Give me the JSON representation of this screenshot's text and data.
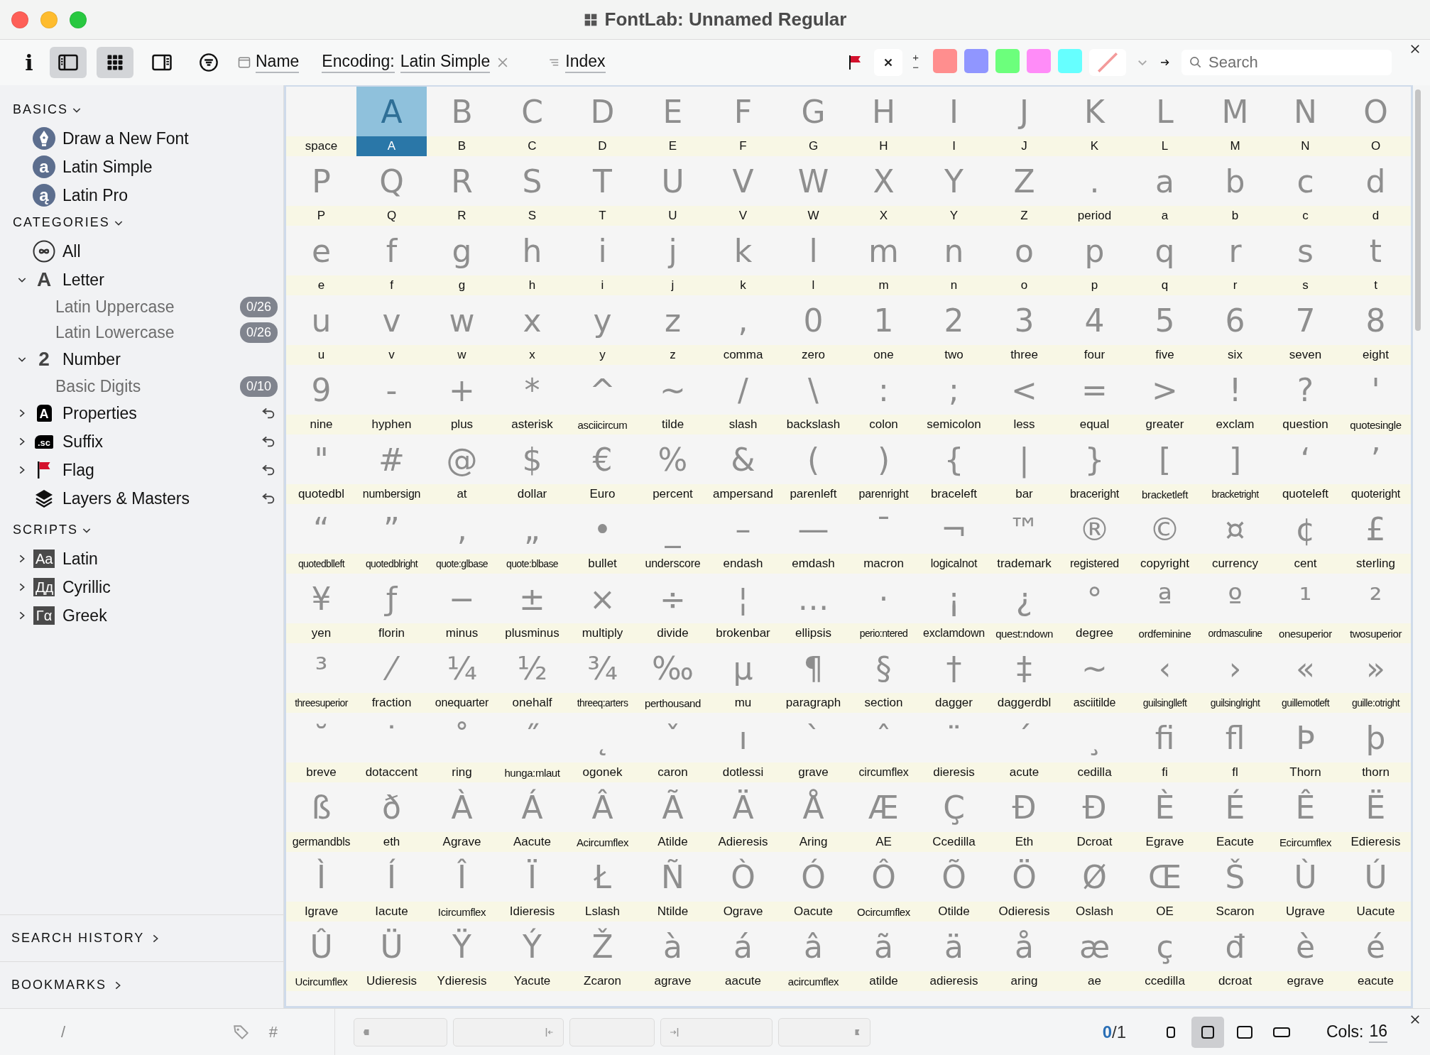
{
  "window": {
    "title": "FontLab: Unnamed Regular"
  },
  "toolbar": {
    "info": "i",
    "view_buttons": [
      {
        "kind": "sidebar",
        "selected": true
      },
      {
        "kind": "grid",
        "selected": true
      },
      {
        "kind": "panel",
        "selected": false
      }
    ],
    "name_label": "Name",
    "encoding_label": "Encoding:",
    "encoding_value": "Latin Simple",
    "index_label": "Index",
    "plus": "+",
    "minus": "−",
    "swatches": [
      {
        "color": "#ff8e8e"
      },
      {
        "color": "#9096ff"
      },
      {
        "color": "#6cff7c"
      },
      {
        "color": "#ff8cf8"
      },
      {
        "color": "#66ffff"
      }
    ],
    "search": {
      "placeholder": "Search"
    }
  },
  "sidebar": {
    "basics": {
      "title": "BASICS",
      "items": [
        {
          "label": "Draw a New Font",
          "kind": "pen"
        },
        {
          "label": "Latin Simple",
          "kind": "letter",
          "icon_text": "a"
        },
        {
          "label": "Latin Pro",
          "kind": "letter",
          "icon_text": "ą"
        }
      ]
    },
    "categories": {
      "title": "CATEGORIES",
      "items": [
        {
          "label": "All",
          "kind": "all"
        },
        {
          "label": "Letter",
          "kind": "glyph",
          "icon_text": "A",
          "expanded": true,
          "children": [
            {
              "label": "Latin Uppercase",
              "count": "0/26"
            },
            {
              "label": "Latin Lowercase",
              "count": "0/26"
            }
          ]
        },
        {
          "label": "Number",
          "kind": "glyph",
          "icon_text": "2",
          "expanded": true,
          "children": [
            {
              "label": "Basic Digits",
              "count": "0/10"
            }
          ]
        },
        {
          "label": "Properties",
          "kind": "tag",
          "icon_text": "A",
          "expanded": false,
          "reset": true
        },
        {
          "label": "Suffix",
          "kind": "suffix",
          "icon_text": ".sc",
          "expanded": false,
          "reset": true
        },
        {
          "label": "Flag",
          "kind": "flag",
          "expanded": false,
          "reset": true
        },
        {
          "label": "Layers & Masters",
          "kind": "layers",
          "reset": true
        }
      ]
    },
    "scripts": {
      "title": "SCRIPTS",
      "items": [
        {
          "label": "Latin",
          "icon_text": "Aa",
          "expanded": false
        },
        {
          "label": "Cyrillic",
          "icon_text": "Дд",
          "expanded": false
        },
        {
          "label": "Greek",
          "icon_text": "Γα",
          "expanded": false
        }
      ]
    },
    "search_history": "SEARCH HISTORY",
    "bookmarks": "BOOKMARKS"
  },
  "glyph_grid": {
    "rows": [
      [
        {
          "name": "space",
          "selected": false
        },
        {
          "glyph": "A",
          "name": "A",
          "selected": true
        },
        {
          "glyph": "B",
          "name": "B",
          "selected": false
        },
        {
          "glyph": "C",
          "name": "C",
          "selected": false
        },
        {
          "glyph": "D",
          "name": "D",
          "selected": false
        },
        {
          "glyph": "E",
          "name": "E",
          "selected": false
        },
        {
          "glyph": "F",
          "name": "F",
          "selected": false
        },
        {
          "glyph": "G",
          "name": "G",
          "selected": false
        },
        {
          "glyph": "H",
          "name": "H",
          "selected": false
        },
        {
          "glyph": "I",
          "name": "I",
          "selected": false
        },
        {
          "glyph": "J",
          "name": "J",
          "selected": false
        },
        {
          "glyph": "K",
          "name": "K",
          "selected": false
        },
        {
          "glyph": "L",
          "name": "L",
          "selected": false
        },
        {
          "glyph": "M",
          "name": "M",
          "selected": false
        },
        {
          "glyph": "N",
          "name": "N",
          "selected": false
        },
        {
          "glyph": "O",
          "name": "O",
          "selected": false
        }
      ],
      [
        {
          "glyph": "P",
          "name": "P",
          "selected": false
        },
        {
          "glyph": "Q",
          "name": "Q",
          "selected": false
        },
        {
          "glyph": "R",
          "name": "R",
          "selected": false
        },
        {
          "glyph": "S",
          "name": "S",
          "selected": false
        },
        {
          "glyph": "T",
          "name": "T",
          "selected": false
        },
        {
          "glyph": "U",
          "name": "U",
          "selected": false
        },
        {
          "glyph": "V",
          "name": "V",
          "selected": false
        },
        {
          "glyph": "W",
          "name": "W",
          "selected": false
        },
        {
          "glyph": "X",
          "name": "X",
          "selected": false
        },
        {
          "glyph": "Y",
          "name": "Y",
          "selected": false
        },
        {
          "glyph": "Z",
          "name": "Z",
          "selected": false
        },
        {
          "glyph": ".",
          "name": "period",
          "selected": false
        },
        {
          "glyph": "a",
          "name": "a",
          "selected": false
        },
        {
          "glyph": "b",
          "name": "b",
          "selected": false
        },
        {
          "glyph": "c",
          "name": "c",
          "selected": false
        },
        {
          "glyph": "d",
          "name": "d",
          "selected": false
        }
      ],
      [
        {
          "glyph": "e",
          "name": "e",
          "selected": false
        },
        {
          "glyph": "f",
          "name": "f",
          "selected": false
        },
        {
          "glyph": "g",
          "name": "g",
          "selected": false
        },
        {
          "glyph": "h",
          "name": "h",
          "selected": false
        },
        {
          "glyph": "i",
          "name": "i",
          "selected": false
        },
        {
          "glyph": "j",
          "name": "j",
          "selected": false
        },
        {
          "glyph": "k",
          "name": "k",
          "selected": false
        },
        {
          "glyph": "l",
          "name": "l",
          "selected": false
        },
        {
          "glyph": "m",
          "name": "m",
          "selected": false
        },
        {
          "glyph": "n",
          "name": "n",
          "selected": false
        },
        {
          "glyph": "o",
          "name": "o",
          "selected": false
        },
        {
          "glyph": "p",
          "name": "p",
          "selected": false
        },
        {
          "glyph": "q",
          "name": "q",
          "selected": false
        },
        {
          "glyph": "r",
          "name": "r",
          "selected": false
        },
        {
          "glyph": "s",
          "name": "s",
          "selected": false
        },
        {
          "glyph": "t",
          "name": "t",
          "selected": false
        }
      ],
      [
        {
          "glyph": "u",
          "name": "u",
          "selected": false
        },
        {
          "glyph": "v",
          "name": "v",
          "selected": false
        },
        {
          "glyph": "w",
          "name": "w",
          "selected": false
        },
        {
          "glyph": "x",
          "name": "x",
          "selected": false
        },
        {
          "glyph": "y",
          "name": "y",
          "selected": false
        },
        {
          "glyph": "z",
          "name": "z",
          "selected": false
        },
        {
          "glyph": ",",
          "name": "comma",
          "selected": false
        },
        {
          "glyph": "0",
          "name": "zero",
          "selected": false
        },
        {
          "glyph": "1",
          "name": "one",
          "selected": false
        },
        {
          "glyph": "2",
          "name": "two",
          "selected": false
        },
        {
          "glyph": "3",
          "name": "three",
          "selected": false
        },
        {
          "glyph": "4",
          "name": "four",
          "selected": false
        },
        {
          "glyph": "5",
          "name": "five",
          "selected": false
        },
        {
          "glyph": "6",
          "name": "six",
          "selected": false
        },
        {
          "glyph": "7",
          "name": "seven",
          "selected": false
        },
        {
          "glyph": "8",
          "name": "eight",
          "selected": false
        }
      ],
      [
        {
          "glyph": "9",
          "name": "nine",
          "selected": false
        },
        {
          "glyph": "-",
          "name": "hyphen",
          "selected": false
        },
        {
          "glyph": "+",
          "name": "plus",
          "selected": false
        },
        {
          "glyph": "*",
          "name": "asterisk",
          "selected": false
        },
        {
          "glyph": "^",
          "name": "asciicircum",
          "selected": false
        },
        {
          "glyph": "~",
          "name": "tilde",
          "selected": false
        },
        {
          "glyph": "/",
          "name": "slash",
          "selected": false
        },
        {
          "glyph": "\\",
          "name": "backslash",
          "selected": false
        },
        {
          "glyph": ":",
          "name": "colon",
          "selected": false
        },
        {
          "glyph": ";",
          "name": "semicolon",
          "selected": false
        },
        {
          "glyph": "<",
          "name": "less",
          "selected": false
        },
        {
          "glyph": "=",
          "name": "equal",
          "selected": false
        },
        {
          "glyph": ">",
          "name": "greater",
          "selected": false
        },
        {
          "glyph": "!",
          "name": "exclam",
          "selected": false
        },
        {
          "glyph": "?",
          "name": "question",
          "selected": false
        },
        {
          "glyph": "'",
          "name": "quotesingle",
          "selected": false
        }
      ],
      [
        {
          "glyph": "\"",
          "name": "quotedbl",
          "selected": false
        },
        {
          "glyph": "#",
          "name": "numbersign",
          "selected": false
        },
        {
          "glyph": "@",
          "name": "at",
          "selected": false
        },
        {
          "glyph": "$",
          "name": "dollar",
          "selected": false
        },
        {
          "glyph": "€",
          "name": "Euro",
          "selected": false
        },
        {
          "glyph": "%",
          "name": "percent",
          "selected": false
        },
        {
          "glyph": "&",
          "name": "ampersand",
          "selected": false
        },
        {
          "glyph": "(",
          "name": "parenleft",
          "selected": false
        },
        {
          "glyph": ")",
          "name": "parenright",
          "selected": false
        },
        {
          "glyph": "{",
          "name": "braceleft",
          "selected": false
        },
        {
          "glyph": "|",
          "name": "bar",
          "selected": false
        },
        {
          "glyph": "}",
          "name": "braceright",
          "selected": false
        },
        {
          "glyph": "[",
          "name": "bracketleft",
          "selected": false
        },
        {
          "glyph": "]",
          "name": "bracketright",
          "selected": false
        },
        {
          "glyph": "‘",
          "name": "quoteleft",
          "selected": false
        },
        {
          "glyph": "’",
          "name": "quoteright",
          "selected": false
        }
      ],
      [
        {
          "glyph": "“",
          "name": "quotedblleft",
          "selected": false
        },
        {
          "glyph": "”",
          "name": "quotedblright",
          "selected": false
        },
        {
          "glyph": "‚",
          "name": "quote:glbase",
          "selected": false
        },
        {
          "glyph": "„",
          "name": "quote:blbase",
          "selected": false
        },
        {
          "glyph": "•",
          "name": "bullet",
          "selected": false
        },
        {
          "glyph": "_",
          "name": "underscore",
          "selected": false
        },
        {
          "glyph": "–",
          "name": "endash",
          "selected": false
        },
        {
          "glyph": "—",
          "name": "emdash",
          "selected": false
        },
        {
          "glyph": "¯",
          "name": "macron",
          "selected": false
        },
        {
          "glyph": "¬",
          "name": "logicalnot",
          "selected": false
        },
        {
          "glyph": "™",
          "name": "trademark",
          "selected": false
        },
        {
          "glyph": "®",
          "name": "registered",
          "selected": false
        },
        {
          "glyph": "©",
          "name": "copyright",
          "selected": false
        },
        {
          "glyph": "¤",
          "name": "currency",
          "selected": false
        },
        {
          "glyph": "¢",
          "name": "cent",
          "selected": false
        },
        {
          "glyph": "£",
          "name": "sterling",
          "selected": false
        }
      ],
      [
        {
          "glyph": "¥",
          "name": "yen",
          "selected": false
        },
        {
          "glyph": "ƒ",
          "name": "florin",
          "selected": false
        },
        {
          "glyph": "−",
          "name": "minus",
          "selected": false
        },
        {
          "glyph": "±",
          "name": "plusminus",
          "selected": false
        },
        {
          "glyph": "×",
          "name": "multiply",
          "selected": false
        },
        {
          "glyph": "÷",
          "name": "divide",
          "selected": false
        },
        {
          "glyph": "¦",
          "name": "brokenbar",
          "selected": false
        },
        {
          "glyph": "…",
          "name": "ellipsis",
          "selected": false
        },
        {
          "glyph": "·",
          "name": "perio:ntered",
          "selected": false
        },
        {
          "glyph": "¡",
          "name": "exclamdown",
          "selected": false
        },
        {
          "glyph": "¿",
          "name": "quest:ndown",
          "selected": false
        },
        {
          "glyph": "°",
          "name": "degree",
          "selected": false
        },
        {
          "glyph": "ª",
          "name": "ordfeminine",
          "selected": false
        },
        {
          "glyph": "º",
          "name": "ordmasculine",
          "selected": false
        },
        {
          "glyph": "¹",
          "name": "onesuperior",
          "selected": false
        },
        {
          "glyph": "²",
          "name": "twosuperior",
          "selected": false
        }
      ],
      [
        {
          "glyph": "³",
          "name": "threesuperior",
          "selected": false
        },
        {
          "glyph": "⁄",
          "name": "fraction",
          "selected": false
        },
        {
          "glyph": "¼",
          "name": "onequarter",
          "selected": false
        },
        {
          "glyph": "½",
          "name": "onehalf",
          "selected": false
        },
        {
          "glyph": "¾",
          "name": "threeq:arters",
          "selected": false
        },
        {
          "glyph": "‰",
          "name": "perthousand",
          "selected": false
        },
        {
          "glyph": "µ",
          "name": "mu",
          "selected": false
        },
        {
          "glyph": "¶",
          "name": "paragraph",
          "selected": false
        },
        {
          "glyph": "§",
          "name": "section",
          "selected": false
        },
        {
          "glyph": "†",
          "name": "dagger",
          "selected": false
        },
        {
          "glyph": "‡",
          "name": "daggerdbl",
          "selected": false
        },
        {
          "glyph": "~",
          "name": "asciitilde",
          "selected": false
        },
        {
          "glyph": "‹",
          "name": "guilsinglleft",
          "selected": false
        },
        {
          "glyph": "›",
          "name": "guilsinglright",
          "selected": false
        },
        {
          "glyph": "«",
          "name": "guillemotleft",
          "selected": false
        },
        {
          "glyph": "»",
          "name": "guille:otright",
          "selected": false
        }
      ],
      [
        {
          "glyph": "˘",
          "name": "breve",
          "selected": false
        },
        {
          "glyph": "˙",
          "name": "dotaccent",
          "selected": false
        },
        {
          "glyph": "˚",
          "name": "ring",
          "selected": false
        },
        {
          "glyph": "˝",
          "name": "hunga:mlaut",
          "selected": false
        },
        {
          "glyph": "˛",
          "name": "ogonek",
          "selected": false
        },
        {
          "glyph": "ˇ",
          "name": "caron",
          "selected": false
        },
        {
          "glyph": "ı",
          "name": "dotlessi",
          "selected": false
        },
        {
          "glyph": "`",
          "name": "grave",
          "selected": false
        },
        {
          "glyph": "ˆ",
          "name": "circumflex",
          "selected": false
        },
        {
          "glyph": "¨",
          "name": "dieresis",
          "selected": false
        },
        {
          "glyph": "´",
          "name": "acute",
          "selected": false
        },
        {
          "glyph": "¸",
          "name": "cedilla",
          "selected": false
        },
        {
          "glyph": "ﬁ",
          "name": "fi",
          "selected": false
        },
        {
          "glyph": "ﬂ",
          "name": "fl",
          "selected": false
        },
        {
          "glyph": "Þ",
          "name": "Thorn",
          "selected": false
        },
        {
          "glyph": "þ",
          "name": "thorn",
          "selected": false
        }
      ],
      [
        {
          "glyph": "ß",
          "name": "germandbls",
          "selected": false
        },
        {
          "glyph": "ð",
          "name": "eth",
          "selected": false
        },
        {
          "glyph": "À",
          "name": "Agrave",
          "selected": false
        },
        {
          "glyph": "Á",
          "name": "Aacute",
          "selected": false
        },
        {
          "glyph": "Â",
          "name": "Acircumflex",
          "selected": false
        },
        {
          "glyph": "Ã",
          "name": "Atilde",
          "selected": false
        },
        {
          "glyph": "Ä",
          "name": "Adieresis",
          "selected": false
        },
        {
          "glyph": "Å",
          "name": "Aring",
          "selected": false
        },
        {
          "glyph": "Æ",
          "name": "AE",
          "selected": false
        },
        {
          "glyph": "Ç",
          "name": "Ccedilla",
          "selected": false
        },
        {
          "glyph": "Ð",
          "name": "Eth",
          "selected": false
        },
        {
          "glyph": "Đ",
          "name": "Dcroat",
          "selected": false
        },
        {
          "glyph": "È",
          "name": "Egrave",
          "selected": false
        },
        {
          "glyph": "É",
          "name": "Eacute",
          "selected": false
        },
        {
          "glyph": "Ê",
          "name": "Ecircumflex",
          "selected": false
        },
        {
          "glyph": "Ë",
          "name": "Edieresis",
          "selected": false
        }
      ],
      [
        {
          "glyph": "Ì",
          "name": "Igrave",
          "selected": false
        },
        {
          "glyph": "Í",
          "name": "Iacute",
          "selected": false
        },
        {
          "glyph": "Î",
          "name": "Icircumflex",
          "selected": false
        },
        {
          "glyph": "Ï",
          "name": "Idieresis",
          "selected": false
        },
        {
          "glyph": "Ł",
          "name": "Lslash",
          "selected": false
        },
        {
          "glyph": "Ñ",
          "name": "Ntilde",
          "selected": false
        },
        {
          "glyph": "Ò",
          "name": "Ograve",
          "selected": false
        },
        {
          "glyph": "Ó",
          "name": "Oacute",
          "selected": false
        },
        {
          "glyph": "Ô",
          "name": "Ocircumflex",
          "selected": false
        },
        {
          "glyph": "Õ",
          "name": "Otilde",
          "selected": false
        },
        {
          "glyph": "Ö",
          "name": "Odieresis",
          "selected": false
        },
        {
          "glyph": "Ø",
          "name": "Oslash",
          "selected": false
        },
        {
          "glyph": "Œ",
          "name": "OE",
          "selected": false
        },
        {
          "glyph": "Š",
          "name": "Scaron",
          "selected": false
        },
        {
          "glyph": "Ù",
          "name": "Ugrave",
          "selected": false
        },
        {
          "glyph": "Ú",
          "name": "Uacute",
          "selected": false
        }
      ],
      [
        {
          "glyph": "Û",
          "name": "Ucircumflex",
          "selected": false
        },
        {
          "glyph": "Ü",
          "name": "Udieresis",
          "selected": false
        },
        {
          "glyph": "Ÿ",
          "name": "Ydieresis",
          "selected": false
        },
        {
          "glyph": "Ý",
          "name": "Yacute",
          "selected": false
        },
        {
          "glyph": "Ž",
          "name": "Zcaron",
          "selected": false
        },
        {
          "glyph": "à",
          "name": "agrave",
          "selected": false
        },
        {
          "glyph": "á",
          "name": "aacute",
          "selected": false
        },
        {
          "glyph": "â",
          "name": "acircumflex",
          "selected": false
        },
        {
          "glyph": "ã",
          "name": "atilde",
          "selected": false
        },
        {
          "glyph": "ä",
          "name": "adieresis",
          "selected": false
        },
        {
          "glyph": "å",
          "name": "aring",
          "selected": false
        },
        {
          "glyph": "æ",
          "name": "ae",
          "selected": false
        },
        {
          "glyph": "ç",
          "name": "ccedilla",
          "selected": false
        },
        {
          "glyph": "đ",
          "name": "dcroat",
          "selected": false
        },
        {
          "glyph": "è",
          "name": "egrave",
          "selected": false
        },
        {
          "glyph": "é",
          "name": "eacute",
          "selected": false
        }
      ]
    ]
  },
  "status_bar": {
    "slash": "/",
    "hash": "#",
    "fields": [
      {
        "kind": "left"
      },
      {
        "kind": "start"
      },
      {
        "kind": "plain"
      },
      {
        "kind": "end"
      },
      {
        "kind": "right"
      }
    ],
    "count_current": "0",
    "count_total": "/1",
    "cell_sizes": [
      {
        "selected": false
      },
      {
        "selected": true
      },
      {
        "selected": false
      },
      {
        "selected": false
      }
    ],
    "cols_label": "Cols:",
    "cols_value": "16"
  }
}
